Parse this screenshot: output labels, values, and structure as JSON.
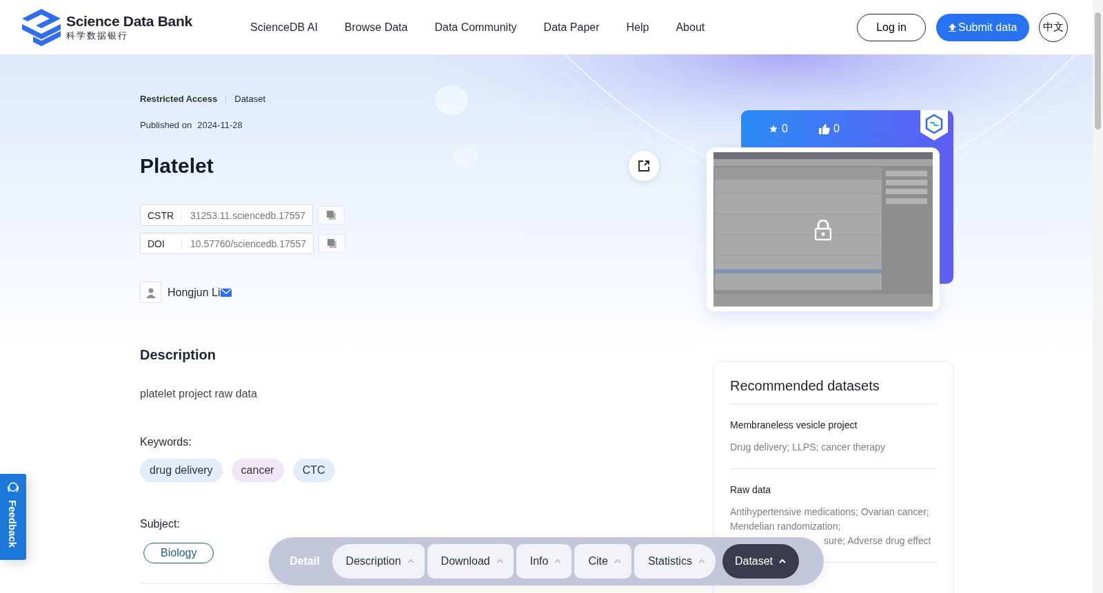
{
  "header": {
    "logo_title": "Science Data Bank",
    "logo_subtitle": "科学数据银行",
    "nav": [
      "ScienceDB AI",
      "Browse Data",
      "Data Community",
      "Data Paper",
      "Help",
      "About"
    ],
    "login": "Log in",
    "submit": "Submit data",
    "language": "中文"
  },
  "dataset": {
    "access": "Restricted Access",
    "type": "Dataset",
    "published_label": "Published on",
    "published_date": "2024-11-28",
    "title": "Platelet",
    "identifiers": [
      {
        "label": "CSTR",
        "value": "31253.11.sciencedb.17557"
      },
      {
        "label": "DOI",
        "value": "10.57760/sciencedb.17557"
      }
    ],
    "author": "Hongjun Li",
    "description_heading": "Description",
    "description": "platelet project raw data",
    "keywords_label": "Keywords:",
    "keywords": [
      {
        "text": "drug delivery",
        "color": "#e3ecfa"
      },
      {
        "text": "cancer",
        "color": "#f0e6f7"
      },
      {
        "text": "CTC",
        "color": "#e3ecfa"
      }
    ],
    "subject_label": "Subject:",
    "subjects": [
      "Biology"
    ]
  },
  "stats": {
    "stars": "0",
    "likes": "0"
  },
  "recommended": {
    "title": "Recommended datasets",
    "items": [
      {
        "name": "Membraneless vesicle project",
        "lines": [
          "Drug delivery; LLPS; cancer therapy"
        ]
      },
      {
        "name": "Raw data",
        "lines": [
          "Antihypertensive medications; Ovarian cancer;",
          "Mendelian randomization;",
          "sure; Adverse drug effect"
        ]
      }
    ]
  },
  "feedback": "Feedback",
  "section_bar": {
    "label": "Detail",
    "tabs": [
      {
        "label": "Description",
        "selected": false
      },
      {
        "label": "Download",
        "selected": false
      },
      {
        "label": "Info",
        "selected": false
      },
      {
        "label": "Cite",
        "selected": false
      },
      {
        "label": "Statistics",
        "selected": false
      },
      {
        "label": "Dataset",
        "selected": true
      }
    ]
  }
}
